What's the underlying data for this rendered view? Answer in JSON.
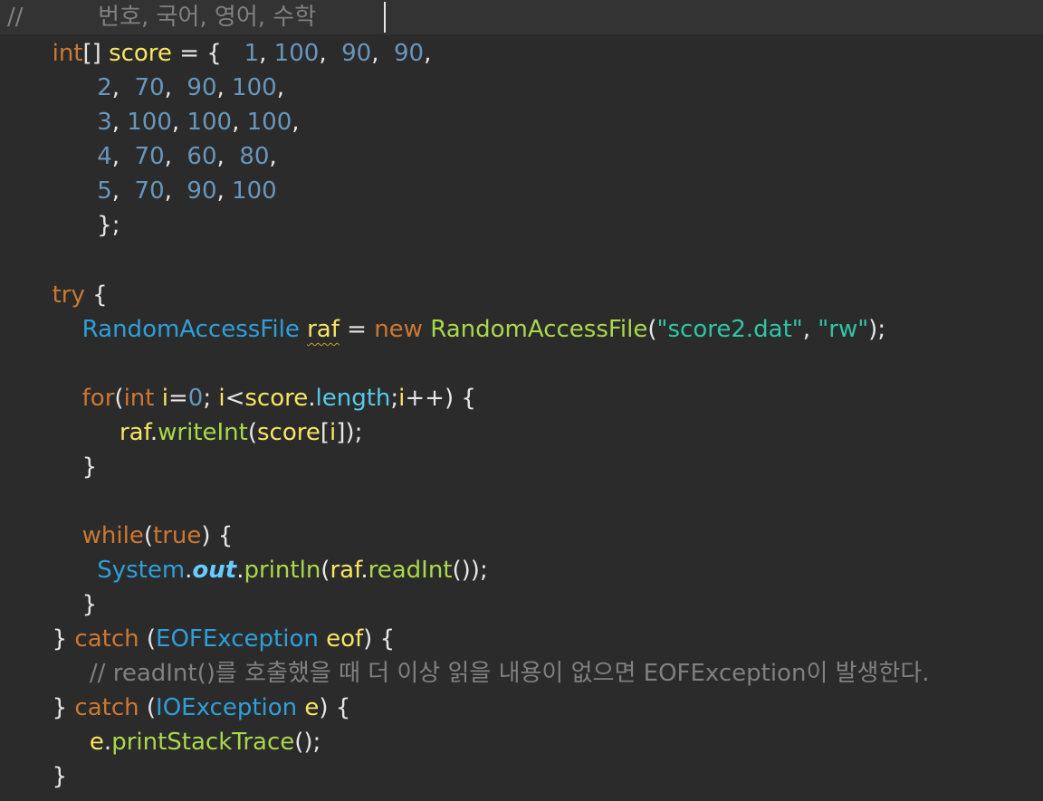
{
  "editor": {
    "lines": [
      [
        {
          "t": "//",
          "c": "cmt"
        },
        {
          "t": "          번호, 국어, 영어, 수학",
          "c": "cmt"
        }
      ],
      [
        {
          "t": "      ",
          "c": "plain"
        },
        {
          "t": "int",
          "c": "kw"
        },
        {
          "t": "[] ",
          "c": "plain"
        },
        {
          "t": "score",
          "c": "var"
        },
        {
          "t": " = {   ",
          "c": "plain"
        },
        {
          "t": "1",
          "c": "num"
        },
        {
          "t": ", ",
          "c": "plain"
        },
        {
          "t": "100",
          "c": "num"
        },
        {
          "t": ",  ",
          "c": "plain"
        },
        {
          "t": "90",
          "c": "num"
        },
        {
          "t": ",  ",
          "c": "plain"
        },
        {
          "t": "90",
          "c": "num"
        },
        {
          "t": ",",
          "c": "plain"
        }
      ],
      [
        {
          "t": "            ",
          "c": "plain"
        },
        {
          "t": "2",
          "c": "num"
        },
        {
          "t": ",  ",
          "c": "plain"
        },
        {
          "t": "70",
          "c": "num"
        },
        {
          "t": ",  ",
          "c": "plain"
        },
        {
          "t": "90",
          "c": "num"
        },
        {
          "t": ", ",
          "c": "plain"
        },
        {
          "t": "100",
          "c": "num"
        },
        {
          "t": ",",
          "c": "plain"
        }
      ],
      [
        {
          "t": "            ",
          "c": "plain"
        },
        {
          "t": "3",
          "c": "num"
        },
        {
          "t": ", ",
          "c": "plain"
        },
        {
          "t": "100",
          "c": "num"
        },
        {
          "t": ", ",
          "c": "plain"
        },
        {
          "t": "100",
          "c": "num"
        },
        {
          "t": ", ",
          "c": "plain"
        },
        {
          "t": "100",
          "c": "num"
        },
        {
          "t": ",",
          "c": "plain"
        }
      ],
      [
        {
          "t": "            ",
          "c": "plain"
        },
        {
          "t": "4",
          "c": "num"
        },
        {
          "t": ",  ",
          "c": "plain"
        },
        {
          "t": "70",
          "c": "num"
        },
        {
          "t": ",  ",
          "c": "plain"
        },
        {
          "t": "60",
          "c": "num"
        },
        {
          "t": ",  ",
          "c": "plain"
        },
        {
          "t": "80",
          "c": "num"
        },
        {
          "t": ",",
          "c": "plain"
        }
      ],
      [
        {
          "t": "            ",
          "c": "plain"
        },
        {
          "t": "5",
          "c": "num"
        },
        {
          "t": ",  ",
          "c": "plain"
        },
        {
          "t": "70",
          "c": "num"
        },
        {
          "t": ",  ",
          "c": "plain"
        },
        {
          "t": "90",
          "c": "num"
        },
        {
          "t": ", ",
          "c": "plain"
        },
        {
          "t": "100",
          "c": "num"
        }
      ],
      [
        {
          "t": "            };",
          "c": "plain"
        }
      ],
      [],
      [
        {
          "t": "      ",
          "c": "plain"
        },
        {
          "t": "try",
          "c": "kw"
        },
        {
          "t": " {",
          "c": "plain"
        }
      ],
      [
        {
          "t": "          ",
          "c": "plain"
        },
        {
          "t": "RandomAccessFile",
          "c": "type"
        },
        {
          "t": " ",
          "c": "plain"
        },
        {
          "t": "raf",
          "c": "var warn"
        },
        {
          "t": " = ",
          "c": "plain"
        },
        {
          "t": "new",
          "c": "kw"
        },
        {
          "t": " ",
          "c": "plain"
        },
        {
          "t": "RandomAccessFile",
          "c": "method"
        },
        {
          "t": "(",
          "c": "plain"
        },
        {
          "t": "\"score2.dat\"",
          "c": "str"
        },
        {
          "t": ", ",
          "c": "plain"
        },
        {
          "t": "\"rw\"",
          "c": "str"
        },
        {
          "t": ");",
          "c": "plain"
        }
      ],
      [],
      [
        {
          "t": "          ",
          "c": "plain"
        },
        {
          "t": "for",
          "c": "kw"
        },
        {
          "t": "(",
          "c": "plain"
        },
        {
          "t": "int",
          "c": "kw"
        },
        {
          "t": " ",
          "c": "plain"
        },
        {
          "t": "i",
          "c": "var"
        },
        {
          "t": "=",
          "c": "plain"
        },
        {
          "t": "0",
          "c": "num"
        },
        {
          "t": "; ",
          "c": "plain"
        },
        {
          "t": "i",
          "c": "var"
        },
        {
          "t": "<",
          "c": "plain"
        },
        {
          "t": "score",
          "c": "var"
        },
        {
          "t": ".",
          "c": "plain"
        },
        {
          "t": "length",
          "c": "field"
        },
        {
          "t": ";",
          "c": "plain"
        },
        {
          "t": "i",
          "c": "var"
        },
        {
          "t": "++) {",
          "c": "plain"
        }
      ],
      [
        {
          "t": "               ",
          "c": "plain"
        },
        {
          "t": "raf",
          "c": "var"
        },
        {
          "t": ".",
          "c": "plain"
        },
        {
          "t": "writeInt",
          "c": "method"
        },
        {
          "t": "(",
          "c": "plain"
        },
        {
          "t": "score",
          "c": "var"
        },
        {
          "t": "[",
          "c": "plain"
        },
        {
          "t": "i",
          "c": "var"
        },
        {
          "t": "]);",
          "c": "plain"
        }
      ],
      [
        {
          "t": "          }",
          "c": "plain"
        }
      ],
      [],
      [
        {
          "t": "          ",
          "c": "plain"
        },
        {
          "t": "while",
          "c": "kw"
        },
        {
          "t": "(",
          "c": "plain"
        },
        {
          "t": "true",
          "c": "bool"
        },
        {
          "t": ") {",
          "c": "plain"
        }
      ],
      [
        {
          "t": "            ",
          "c": "plain"
        },
        {
          "t": "System",
          "c": "type"
        },
        {
          "t": ".",
          "c": "plain"
        },
        {
          "t": "out",
          "c": "static-field"
        },
        {
          "t": ".",
          "c": "plain"
        },
        {
          "t": "println",
          "c": "method"
        },
        {
          "t": "(",
          "c": "plain"
        },
        {
          "t": "raf",
          "c": "var"
        },
        {
          "t": ".",
          "c": "plain"
        },
        {
          "t": "readInt",
          "c": "method"
        },
        {
          "t": "());",
          "c": "plain"
        }
      ],
      [
        {
          "t": "          }",
          "c": "plain"
        }
      ],
      [
        {
          "t": "      } ",
          "c": "plain"
        },
        {
          "t": "catch",
          "c": "kw"
        },
        {
          "t": " (",
          "c": "plain"
        },
        {
          "t": "EOFException",
          "c": "type"
        },
        {
          "t": " ",
          "c": "plain"
        },
        {
          "t": "eof",
          "c": "var"
        },
        {
          "t": ") {",
          "c": "plain"
        }
      ],
      [
        {
          "t": "           ",
          "c": "plain"
        },
        {
          "t": "// readInt()를 호출했을 때 더 이상 읽을 내용이 없으면 EOFException이 발생한다.",
          "c": "cmt"
        }
      ],
      [
        {
          "t": "      } ",
          "c": "plain"
        },
        {
          "t": "catch",
          "c": "kw"
        },
        {
          "t": " (",
          "c": "plain"
        },
        {
          "t": "IOException",
          "c": "type"
        },
        {
          "t": " ",
          "c": "plain"
        },
        {
          "t": "e",
          "c": "var"
        },
        {
          "t": ") {",
          "c": "plain"
        }
      ],
      [
        {
          "t": "           ",
          "c": "plain"
        },
        {
          "t": "e",
          "c": "var"
        },
        {
          "t": ".",
          "c": "plain"
        },
        {
          "t": "printStackTrace",
          "c": "method"
        },
        {
          "t": "();",
          "c": "plain"
        }
      ],
      [
        {
          "t": "      }",
          "c": "plain"
        }
      ]
    ]
  },
  "colors": {
    "background": "#2b2b2b",
    "current_line": "#333333",
    "keyword": "#cc7832",
    "type": "#2f9fd8",
    "variable": "#f5e663",
    "number": "#6897bb",
    "string": "#2fc5a5",
    "comment": "#808080",
    "method": "#a9d94a",
    "field": "#55c9e8"
  }
}
